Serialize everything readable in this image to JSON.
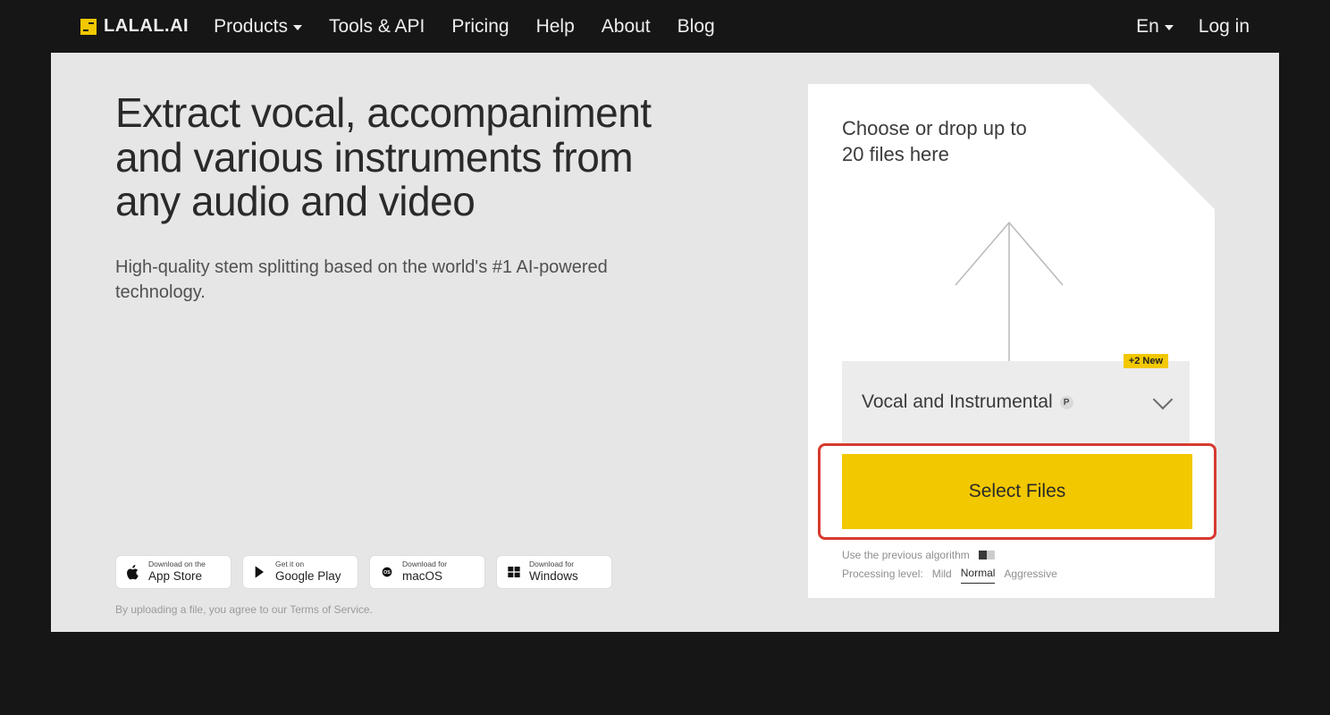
{
  "brand": {
    "name": "LALAL.AI"
  },
  "nav": {
    "products": "Products",
    "tools": "Tools & API",
    "pricing": "Pricing",
    "help": "Help",
    "about": "About",
    "blog": "Blog",
    "lang": "En",
    "login": "Log in"
  },
  "hero": {
    "headline": "Extract vocal, accompaniment and various instruments from any audio and video",
    "subhead": "High-quality stem splitting based on the world's #1 AI-powered technology."
  },
  "downloads": {
    "appstore": {
      "top": "Download on the",
      "bottom": "App Store"
    },
    "gplay": {
      "top": "Get it on",
      "bottom": "Google Play"
    },
    "macos": {
      "top": "Download for",
      "bottom": "macOS"
    },
    "windows": {
      "top": "Download for",
      "bottom": "Windows"
    }
  },
  "tos": {
    "prefix": "By uploading a file, you agree to our ",
    "link": "Terms of Service",
    "suffix": "."
  },
  "upload": {
    "drop": "Choose or drop up to 20 files here",
    "new_badge": "+2 New",
    "stem_selected": "Vocal and Instrumental",
    "select_btn": "Select Files",
    "prev_algo": "Use the previous algorithm",
    "proc_label": "Processing level:",
    "proc": {
      "mild": "Mild",
      "normal": "Normal",
      "aggressive": "Aggressive"
    }
  }
}
